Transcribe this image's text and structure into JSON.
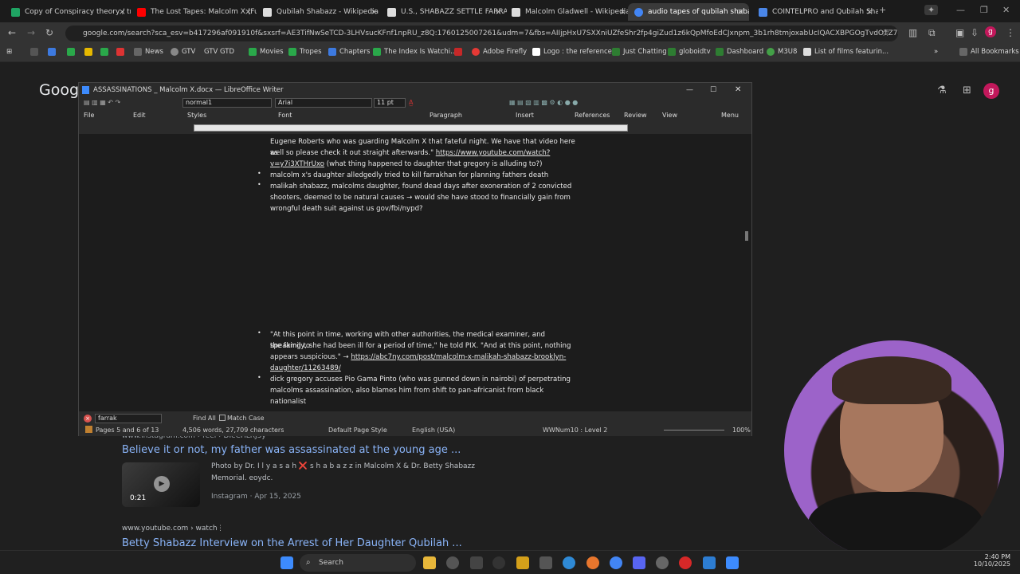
{
  "browser": {
    "tabs": [
      {
        "label": "Copy of Conspiracy theory / tr",
        "icon": "sheets-icon",
        "color": "#1fa463"
      },
      {
        "label": "The Lost Tapes: Malcolm X (Ful",
        "icon": "youtube-icon",
        "color": "#ff0000"
      },
      {
        "label": "Qubilah Shabazz - Wikipedia",
        "icon": "wikipedia-icon",
        "color": "#dddddd"
      },
      {
        "label": "U.S., SHABAZZ SETTLE FARRAK",
        "icon": "ap-icon",
        "color": "#dddddd"
      },
      {
        "label": "Malcolm Gladwell - Wikipedia",
        "icon": "wikipedia-icon",
        "color": "#dddddd"
      },
      {
        "label": "audio tapes of qubilah shabaz",
        "icon": "google-icon",
        "color": "#4285f4"
      },
      {
        "label": "COINTELPRO and Qubilah Sha",
        "icon": "doc-icon",
        "color": "#4a86e8"
      }
    ],
    "url": "google.com/search?sca_esv=b417296af091910f&sxsrf=AE3TifNwSeTCD-3LHVsucKFnf1npRU_z8Q:1760125007261&udm=7&fbs=AIIjpHxU7SXXniUZfeShr2fp4giZud1z6kQpMfoEdCJxnpm_3b1rh8tmjoxabUcIQACXBPGOgTvdOTZ7-BDqvnYatn...",
    "bookmarks": [
      "Movies",
      "News",
      "GTV",
      "GTV GTD",
      "Movies",
      "Tropes",
      "Chapters",
      "The Index Is Watchi...",
      "",
      "Adobe Firefly",
      "Logo : the reference...",
      "Just Chatting",
      "globoidtv",
      "Dashboard",
      "M3U8",
      "List of films featurin..."
    ],
    "all_bookmarks": "All Bookmarks"
  },
  "google": {
    "logo_partial": "Goog",
    "result1": {
      "source": "www.instagram.com › reel › DIeCHLRJ3y",
      "title": "Believe it or not, my father was assassinated at the young age ...",
      "snippet_line1": "Photo by Dr. I l y a s a h ❌ s h a b a z z in Malcolm X & Dr. Betty Shabazz",
      "snippet_line2": "Memorial. eoydc.",
      "meta": "Instagram · Apr 15, 2025",
      "duration": "0:21"
    },
    "result2": {
      "source": "www.youtube.com › watch",
      "title": "Betty Shabazz Interview on the Arrest of Her Daughter Qubilah ..."
    }
  },
  "writer": {
    "title": "ASSASSINATIONS _ Malcolm X.docx — LibreOffice Writer",
    "para_style": "normal1",
    "font": "Arial",
    "size": "11 pt",
    "menus": [
      "File",
      "Edit",
      "Styles",
      "Font",
      "Paragraph",
      "Insert",
      "References",
      "Review",
      "View",
      "Menu"
    ],
    "doc": {
      "line_a": "Eugene Roberts who was guarding Malcolm X that fateful night. We have that video here as",
      "line_b_pre": "well so please check it out straight afterwards.\"",
      "line_b_link": "https://www.youtube.com/watch?",
      "line_c_link": "v=y7i3XTHrUxo",
      "line_c_post": " (what thing happened to daughter that gregory is alluding to?)",
      "bullet1": "malcolm x's daughter alledgedly tried to kill farrakhan for planning fathers death",
      "bullet2_l1": "malikah shabazz, malcolms daughter, found dead days after exoneration of 2 convicted",
      "bullet2_l2": "shooters, deemed to be natural causes → would she have stood to financially gain from",
      "bullet2_l3": "wrongful death suit against us gov/fbi/nypd?",
      "bullet3_l1": "\"At this point in time, working with other authorities, the medical examiner, and speaking to",
      "bullet3_l2": "the family, she had been ill for a period of time,\" he told PIX. \"And at this point, nothing",
      "bullet3_l3_pre": "appears suspicious.\" →",
      "bullet3_l3_link": "https://abc7ny.com/post/malcolm-x-malikah-shabazz-brooklyn-",
      "bullet3_l4_link": "daughter/11263489/",
      "bullet4_l1": "dick gregory accuses Pio Gama Pinto (who was gunned down in nairobi) of perpetrating",
      "bullet4_l2": "malcolms assassination, also blames him from shift to pan-africanist from black",
      "bullet4_l3": "nationalist"
    },
    "find": {
      "value": "farrak",
      "find_all": "Find All",
      "match_case": "Match Case"
    },
    "status": {
      "pages": "Pages 5 and 6 of 13",
      "words": "4,506 words, 27,709 characters",
      "page_style": "Default Page Style",
      "language": "English (USA)",
      "list": "WWNum10 : Level 2",
      "zoom": "100%"
    }
  },
  "taskbar": {
    "search": "Search",
    "time": "2:40 PM",
    "date": "10/10/2025"
  }
}
